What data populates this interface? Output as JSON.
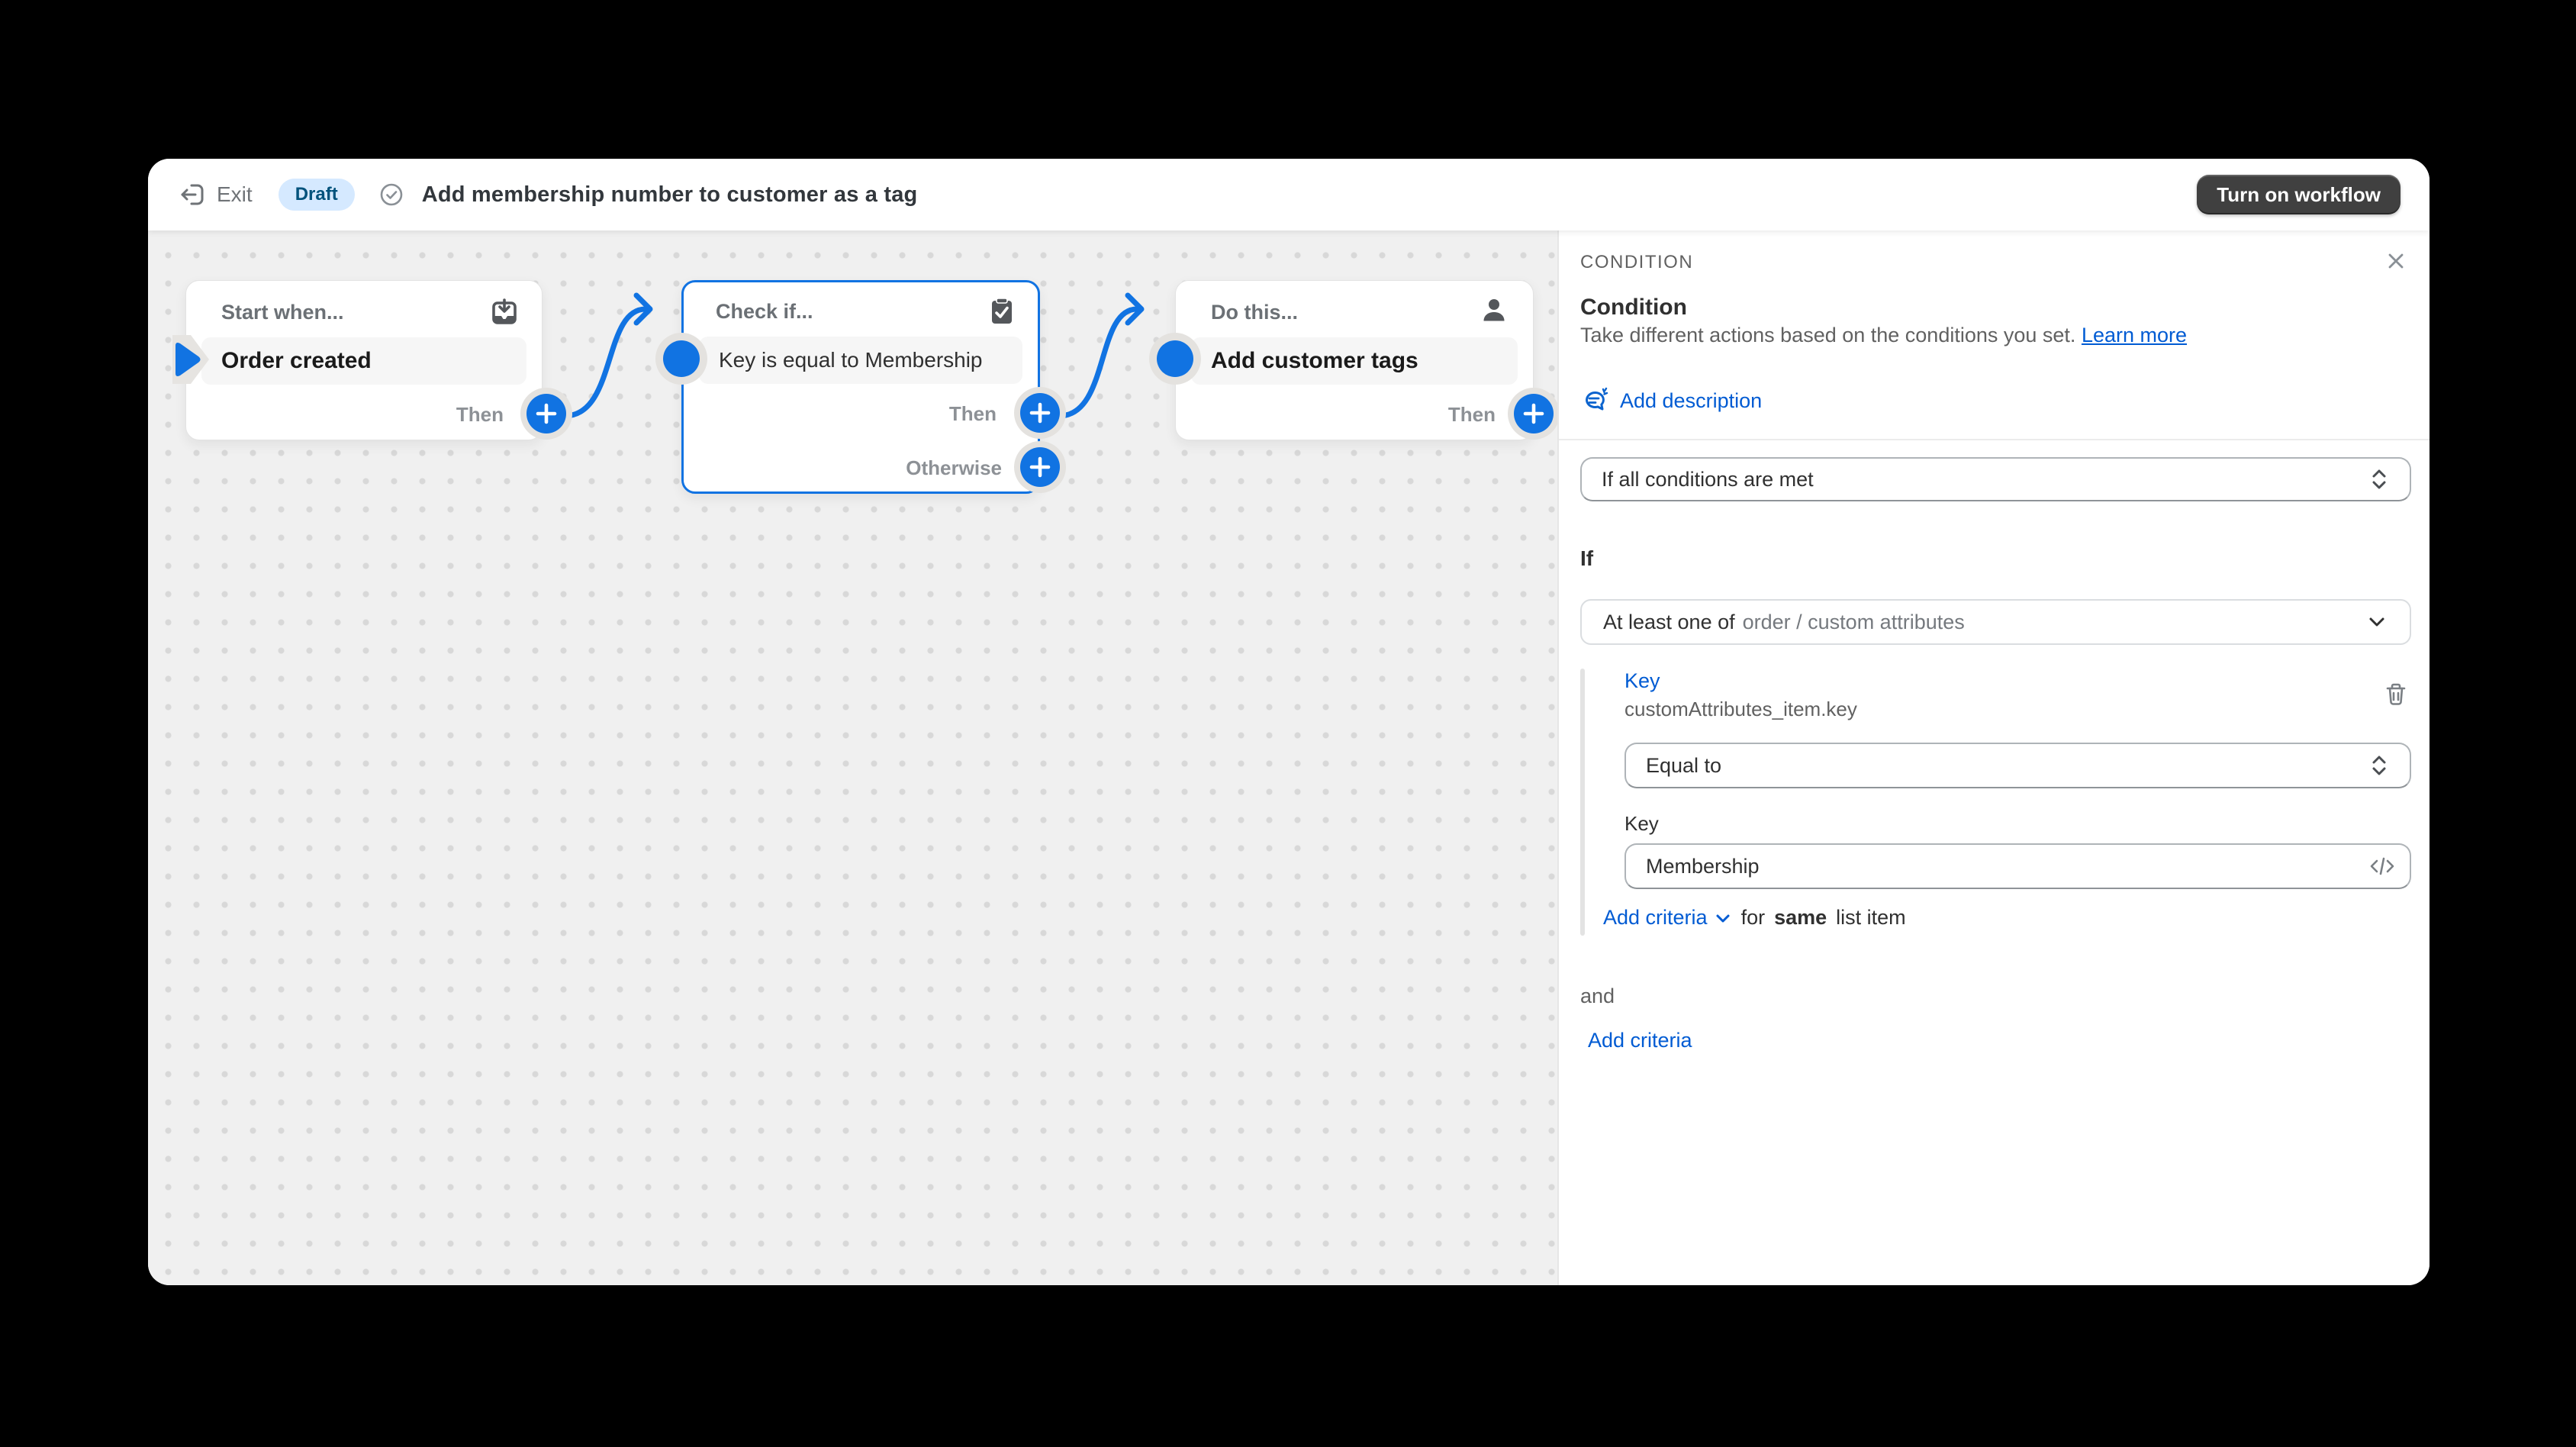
{
  "topbar": {
    "exit": "Exit",
    "status": "Draft",
    "title": "Add membership number to customer as a tag",
    "cta": "Turn on workflow"
  },
  "canvas": {
    "start": {
      "header": "Start when...",
      "body": "Order created",
      "then": "Then"
    },
    "check": {
      "header": "Check if...",
      "body": "Key is equal to Membership",
      "then": "Then",
      "otherwise": "Otherwise"
    },
    "action": {
      "header": "Do this...",
      "body": "Add customer tags",
      "then": "Then"
    }
  },
  "panel": {
    "kicker": "CONDITION",
    "title": "Condition",
    "description": "Take different actions based on the conditions you set.",
    "learn_more": "Learn more",
    "add_description": "Add description",
    "conditions_match_value": "If all conditions are met",
    "if_label": "If",
    "scope_primary": "At least one of",
    "scope_secondary": "order / custom attributes",
    "key_link": "Key",
    "key_path": "customAttributes_item.key",
    "operator_value": "Equal to",
    "key_field_label": "Key",
    "key_field_value": "Membership",
    "add_criteria_inline": "Add criteria",
    "for_text": "for",
    "same_text": "same",
    "list_item_text": "list item",
    "and_label": "and",
    "add_criteria_bottom": "Add criteria"
  },
  "colors": {
    "accent": "#1173E2",
    "link": "#005BD3",
    "badge_bg": "#D5E9FF",
    "badge_text": "#00527C",
    "cta_bg": "#404040"
  }
}
